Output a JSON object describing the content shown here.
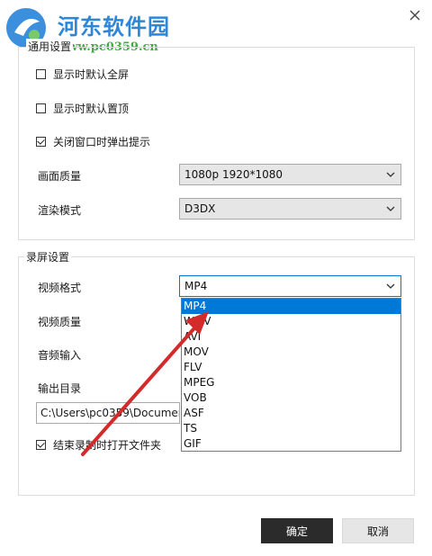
{
  "watermark": {
    "site_name": "河东软件园",
    "url": "www.pc0359.cn"
  },
  "general": {
    "title": "通用设置",
    "fullscreen_label": "显示时默认全屏",
    "fullscreen_checked": false,
    "ontop_label": "显示时默认置顶",
    "ontop_checked": false,
    "close_prompt_label": "关闭窗口时弹出提示",
    "close_prompt_checked": true,
    "quality_label": "画面质量",
    "quality_value": "1080p 1920*1080",
    "render_label": "渲染模式",
    "render_value": "D3DX"
  },
  "record": {
    "title": "录屏设置",
    "format_label": "视频格式",
    "format_value": "MP4",
    "video_quality_label": "视频质量",
    "audio_input_label": "音频输入",
    "output_dir_label": "输出目录",
    "output_dir_value": "C:\\Users\\pc0359\\Documen",
    "open_folder_label": "结束录制时打开文件夹",
    "open_folder_checked": true,
    "format_options": [
      "MP4",
      "WMV",
      "AVI",
      "MOV",
      "FLV",
      "MPEG",
      "VOB",
      "ASF",
      "TS",
      "GIF"
    ],
    "format_selected": "MP4"
  },
  "buttons": {
    "ok": "确定",
    "cancel": "取消"
  },
  "colors": {
    "selection": "#0078d7",
    "arrow": "#d32a2a",
    "ok_bg": "#2b2b2b"
  },
  "icons": {
    "close": "close-icon",
    "chevron": "chevron-down-icon",
    "check": "check-icon"
  }
}
